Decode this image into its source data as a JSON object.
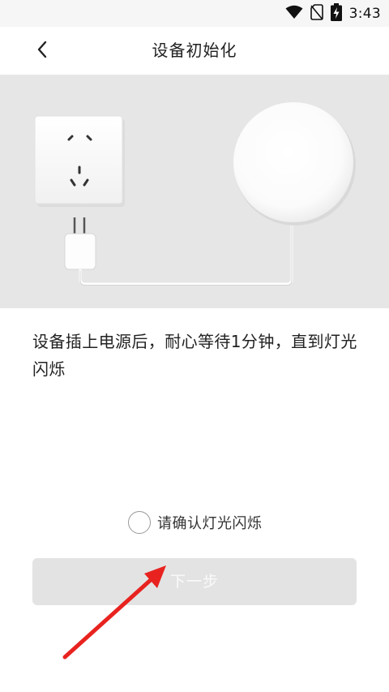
{
  "status_bar": {
    "time": "3:43",
    "icons": [
      "wifi-icon",
      "no-sim-icon",
      "battery-charging-icon"
    ]
  },
  "header": {
    "back_icon": "back-arrow-icon",
    "title": "设备初始化"
  },
  "illustration": {
    "items": [
      "power-socket",
      "usb-power-adapter",
      "power-cable",
      "round-lamp-device"
    ],
    "background_color": "#e6e6e6"
  },
  "instruction": {
    "text": "设备插上电源后，耐心等待1分钟，直到灯光闪烁"
  },
  "confirm": {
    "label": "请确认灯光闪烁",
    "checked": false
  },
  "next_button": {
    "label": "下一步",
    "enabled": false
  },
  "annotation": {
    "icon": "red-pointer-arrow",
    "color": "#e8231f"
  }
}
